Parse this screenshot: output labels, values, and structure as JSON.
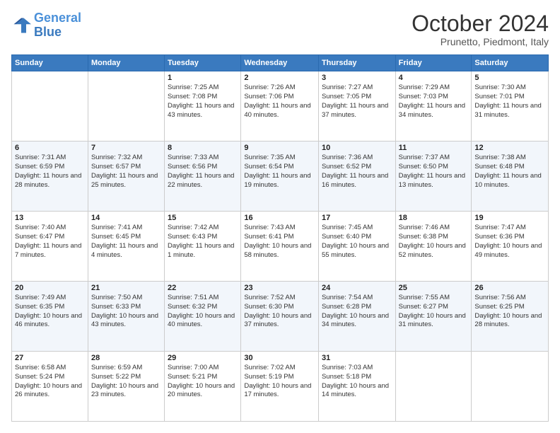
{
  "header": {
    "logo_general": "General",
    "logo_blue": "Blue",
    "month_title": "October 2024",
    "subtitle": "Prunetto, Piedmont, Italy"
  },
  "days_of_week": [
    "Sunday",
    "Monday",
    "Tuesday",
    "Wednesday",
    "Thursday",
    "Friday",
    "Saturday"
  ],
  "weeks": [
    [
      {
        "day": "",
        "sunrise": "",
        "sunset": "",
        "daylight": ""
      },
      {
        "day": "",
        "sunrise": "",
        "sunset": "",
        "daylight": ""
      },
      {
        "day": "1",
        "sunrise": "Sunrise: 7:25 AM",
        "sunset": "Sunset: 7:08 PM",
        "daylight": "Daylight: 11 hours and 43 minutes."
      },
      {
        "day": "2",
        "sunrise": "Sunrise: 7:26 AM",
        "sunset": "Sunset: 7:06 PM",
        "daylight": "Daylight: 11 hours and 40 minutes."
      },
      {
        "day": "3",
        "sunrise": "Sunrise: 7:27 AM",
        "sunset": "Sunset: 7:05 PM",
        "daylight": "Daylight: 11 hours and 37 minutes."
      },
      {
        "day": "4",
        "sunrise": "Sunrise: 7:29 AM",
        "sunset": "Sunset: 7:03 PM",
        "daylight": "Daylight: 11 hours and 34 minutes."
      },
      {
        "day": "5",
        "sunrise": "Sunrise: 7:30 AM",
        "sunset": "Sunset: 7:01 PM",
        "daylight": "Daylight: 11 hours and 31 minutes."
      }
    ],
    [
      {
        "day": "6",
        "sunrise": "Sunrise: 7:31 AM",
        "sunset": "Sunset: 6:59 PM",
        "daylight": "Daylight: 11 hours and 28 minutes."
      },
      {
        "day": "7",
        "sunrise": "Sunrise: 7:32 AM",
        "sunset": "Sunset: 6:57 PM",
        "daylight": "Daylight: 11 hours and 25 minutes."
      },
      {
        "day": "8",
        "sunrise": "Sunrise: 7:33 AM",
        "sunset": "Sunset: 6:56 PM",
        "daylight": "Daylight: 11 hours and 22 minutes."
      },
      {
        "day": "9",
        "sunrise": "Sunrise: 7:35 AM",
        "sunset": "Sunset: 6:54 PM",
        "daylight": "Daylight: 11 hours and 19 minutes."
      },
      {
        "day": "10",
        "sunrise": "Sunrise: 7:36 AM",
        "sunset": "Sunset: 6:52 PM",
        "daylight": "Daylight: 11 hours and 16 minutes."
      },
      {
        "day": "11",
        "sunrise": "Sunrise: 7:37 AM",
        "sunset": "Sunset: 6:50 PM",
        "daylight": "Daylight: 11 hours and 13 minutes."
      },
      {
        "day": "12",
        "sunrise": "Sunrise: 7:38 AM",
        "sunset": "Sunset: 6:48 PM",
        "daylight": "Daylight: 11 hours and 10 minutes."
      }
    ],
    [
      {
        "day": "13",
        "sunrise": "Sunrise: 7:40 AM",
        "sunset": "Sunset: 6:47 PM",
        "daylight": "Daylight: 11 hours and 7 minutes."
      },
      {
        "day": "14",
        "sunrise": "Sunrise: 7:41 AM",
        "sunset": "Sunset: 6:45 PM",
        "daylight": "Daylight: 11 hours and 4 minutes."
      },
      {
        "day": "15",
        "sunrise": "Sunrise: 7:42 AM",
        "sunset": "Sunset: 6:43 PM",
        "daylight": "Daylight: 11 hours and 1 minute."
      },
      {
        "day": "16",
        "sunrise": "Sunrise: 7:43 AM",
        "sunset": "Sunset: 6:41 PM",
        "daylight": "Daylight: 10 hours and 58 minutes."
      },
      {
        "day": "17",
        "sunrise": "Sunrise: 7:45 AM",
        "sunset": "Sunset: 6:40 PM",
        "daylight": "Daylight: 10 hours and 55 minutes."
      },
      {
        "day": "18",
        "sunrise": "Sunrise: 7:46 AM",
        "sunset": "Sunset: 6:38 PM",
        "daylight": "Daylight: 10 hours and 52 minutes."
      },
      {
        "day": "19",
        "sunrise": "Sunrise: 7:47 AM",
        "sunset": "Sunset: 6:36 PM",
        "daylight": "Daylight: 10 hours and 49 minutes."
      }
    ],
    [
      {
        "day": "20",
        "sunrise": "Sunrise: 7:49 AM",
        "sunset": "Sunset: 6:35 PM",
        "daylight": "Daylight: 10 hours and 46 minutes."
      },
      {
        "day": "21",
        "sunrise": "Sunrise: 7:50 AM",
        "sunset": "Sunset: 6:33 PM",
        "daylight": "Daylight: 10 hours and 43 minutes."
      },
      {
        "day": "22",
        "sunrise": "Sunrise: 7:51 AM",
        "sunset": "Sunset: 6:32 PM",
        "daylight": "Daylight: 10 hours and 40 minutes."
      },
      {
        "day": "23",
        "sunrise": "Sunrise: 7:52 AM",
        "sunset": "Sunset: 6:30 PM",
        "daylight": "Daylight: 10 hours and 37 minutes."
      },
      {
        "day": "24",
        "sunrise": "Sunrise: 7:54 AM",
        "sunset": "Sunset: 6:28 PM",
        "daylight": "Daylight: 10 hours and 34 minutes."
      },
      {
        "day": "25",
        "sunrise": "Sunrise: 7:55 AM",
        "sunset": "Sunset: 6:27 PM",
        "daylight": "Daylight: 10 hours and 31 minutes."
      },
      {
        "day": "26",
        "sunrise": "Sunrise: 7:56 AM",
        "sunset": "Sunset: 6:25 PM",
        "daylight": "Daylight: 10 hours and 28 minutes."
      }
    ],
    [
      {
        "day": "27",
        "sunrise": "Sunrise: 6:58 AM",
        "sunset": "Sunset: 5:24 PM",
        "daylight": "Daylight: 10 hours and 26 minutes."
      },
      {
        "day": "28",
        "sunrise": "Sunrise: 6:59 AM",
        "sunset": "Sunset: 5:22 PM",
        "daylight": "Daylight: 10 hours and 23 minutes."
      },
      {
        "day": "29",
        "sunrise": "Sunrise: 7:00 AM",
        "sunset": "Sunset: 5:21 PM",
        "daylight": "Daylight: 10 hours and 20 minutes."
      },
      {
        "day": "30",
        "sunrise": "Sunrise: 7:02 AM",
        "sunset": "Sunset: 5:19 PM",
        "daylight": "Daylight: 10 hours and 17 minutes."
      },
      {
        "day": "31",
        "sunrise": "Sunrise: 7:03 AM",
        "sunset": "Sunset: 5:18 PM",
        "daylight": "Daylight: 10 hours and 14 minutes."
      },
      {
        "day": "",
        "sunrise": "",
        "sunset": "",
        "daylight": ""
      },
      {
        "day": "",
        "sunrise": "",
        "sunset": "",
        "daylight": ""
      }
    ]
  ]
}
